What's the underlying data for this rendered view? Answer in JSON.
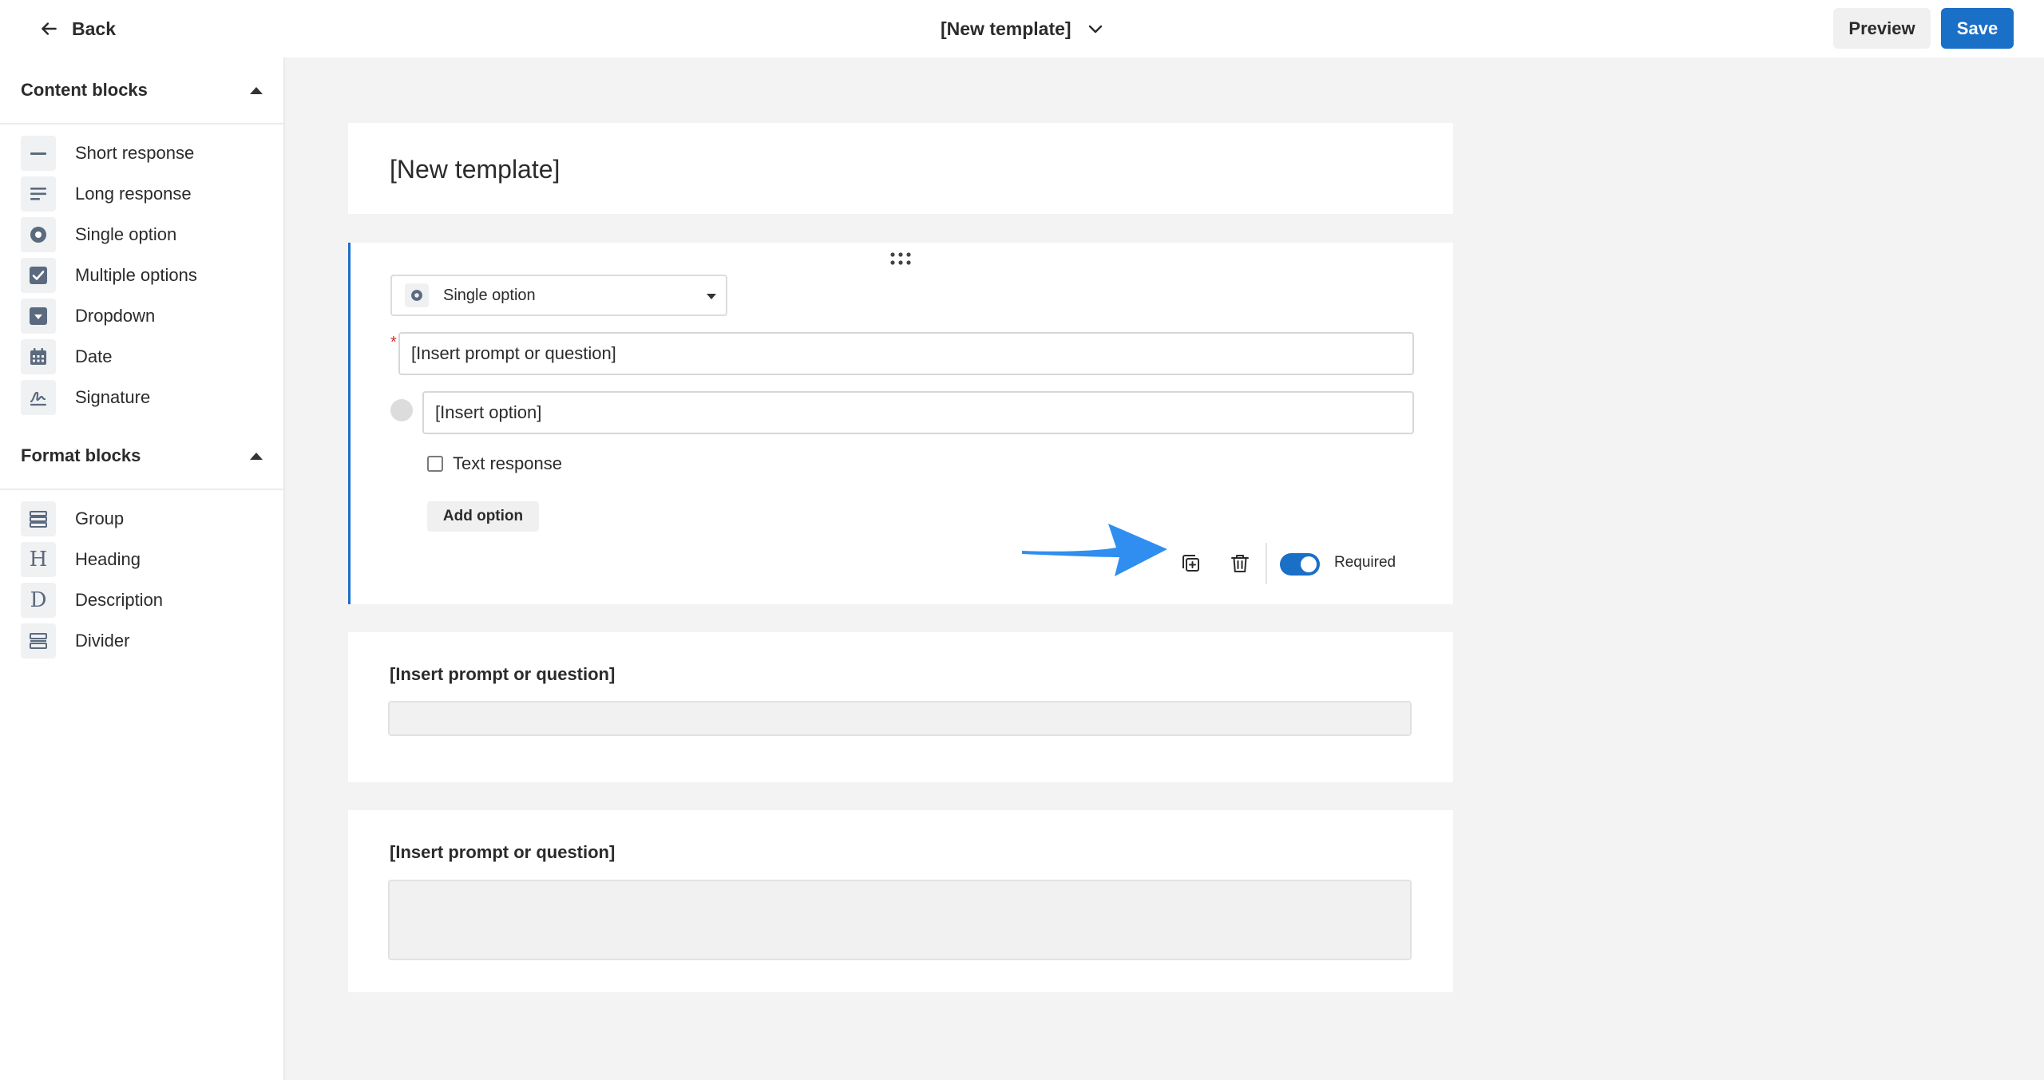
{
  "topbar": {
    "back_label": "Back",
    "template_title": "[New template]",
    "preview_label": "Preview",
    "save_label": "Save"
  },
  "sidebar": {
    "content_heading": "Content blocks",
    "content_items": [
      {
        "label": "Short response",
        "icon": "short-response-icon"
      },
      {
        "label": "Long response",
        "icon": "long-response-icon"
      },
      {
        "label": "Single option",
        "icon": "radio-icon"
      },
      {
        "label": "Multiple options",
        "icon": "checkbox-icon"
      },
      {
        "label": "Dropdown",
        "icon": "dropdown-icon"
      },
      {
        "label": "Date",
        "icon": "calendar-icon"
      },
      {
        "label": "Signature",
        "icon": "signature-icon"
      }
    ],
    "format_heading": "Format blocks",
    "format_items": [
      {
        "label": "Group",
        "icon": "group-icon"
      },
      {
        "label": "Heading",
        "icon": "heading-icon",
        "glyph": "H"
      },
      {
        "label": "Description",
        "icon": "description-icon",
        "glyph": "D"
      },
      {
        "label": "Divider",
        "icon": "divider-icon"
      }
    ]
  },
  "canvas": {
    "title_card": {
      "title": "[New template]"
    },
    "active_block": {
      "type_label": "Single option",
      "prompt_value": "[Insert prompt or question]",
      "option_value": "[Insert option]",
      "text_response_label": "Text response",
      "add_option_label": "Add option",
      "required_label": "Required",
      "required_on": true
    },
    "block2": {
      "prompt": "[Insert prompt or question]"
    },
    "block3": {
      "prompt": "[Insert prompt or question]"
    }
  },
  "colors": {
    "accent": "#1a6fc7",
    "annotation_arrow": "#2f8ef0",
    "required_star": "#d0312d"
  }
}
